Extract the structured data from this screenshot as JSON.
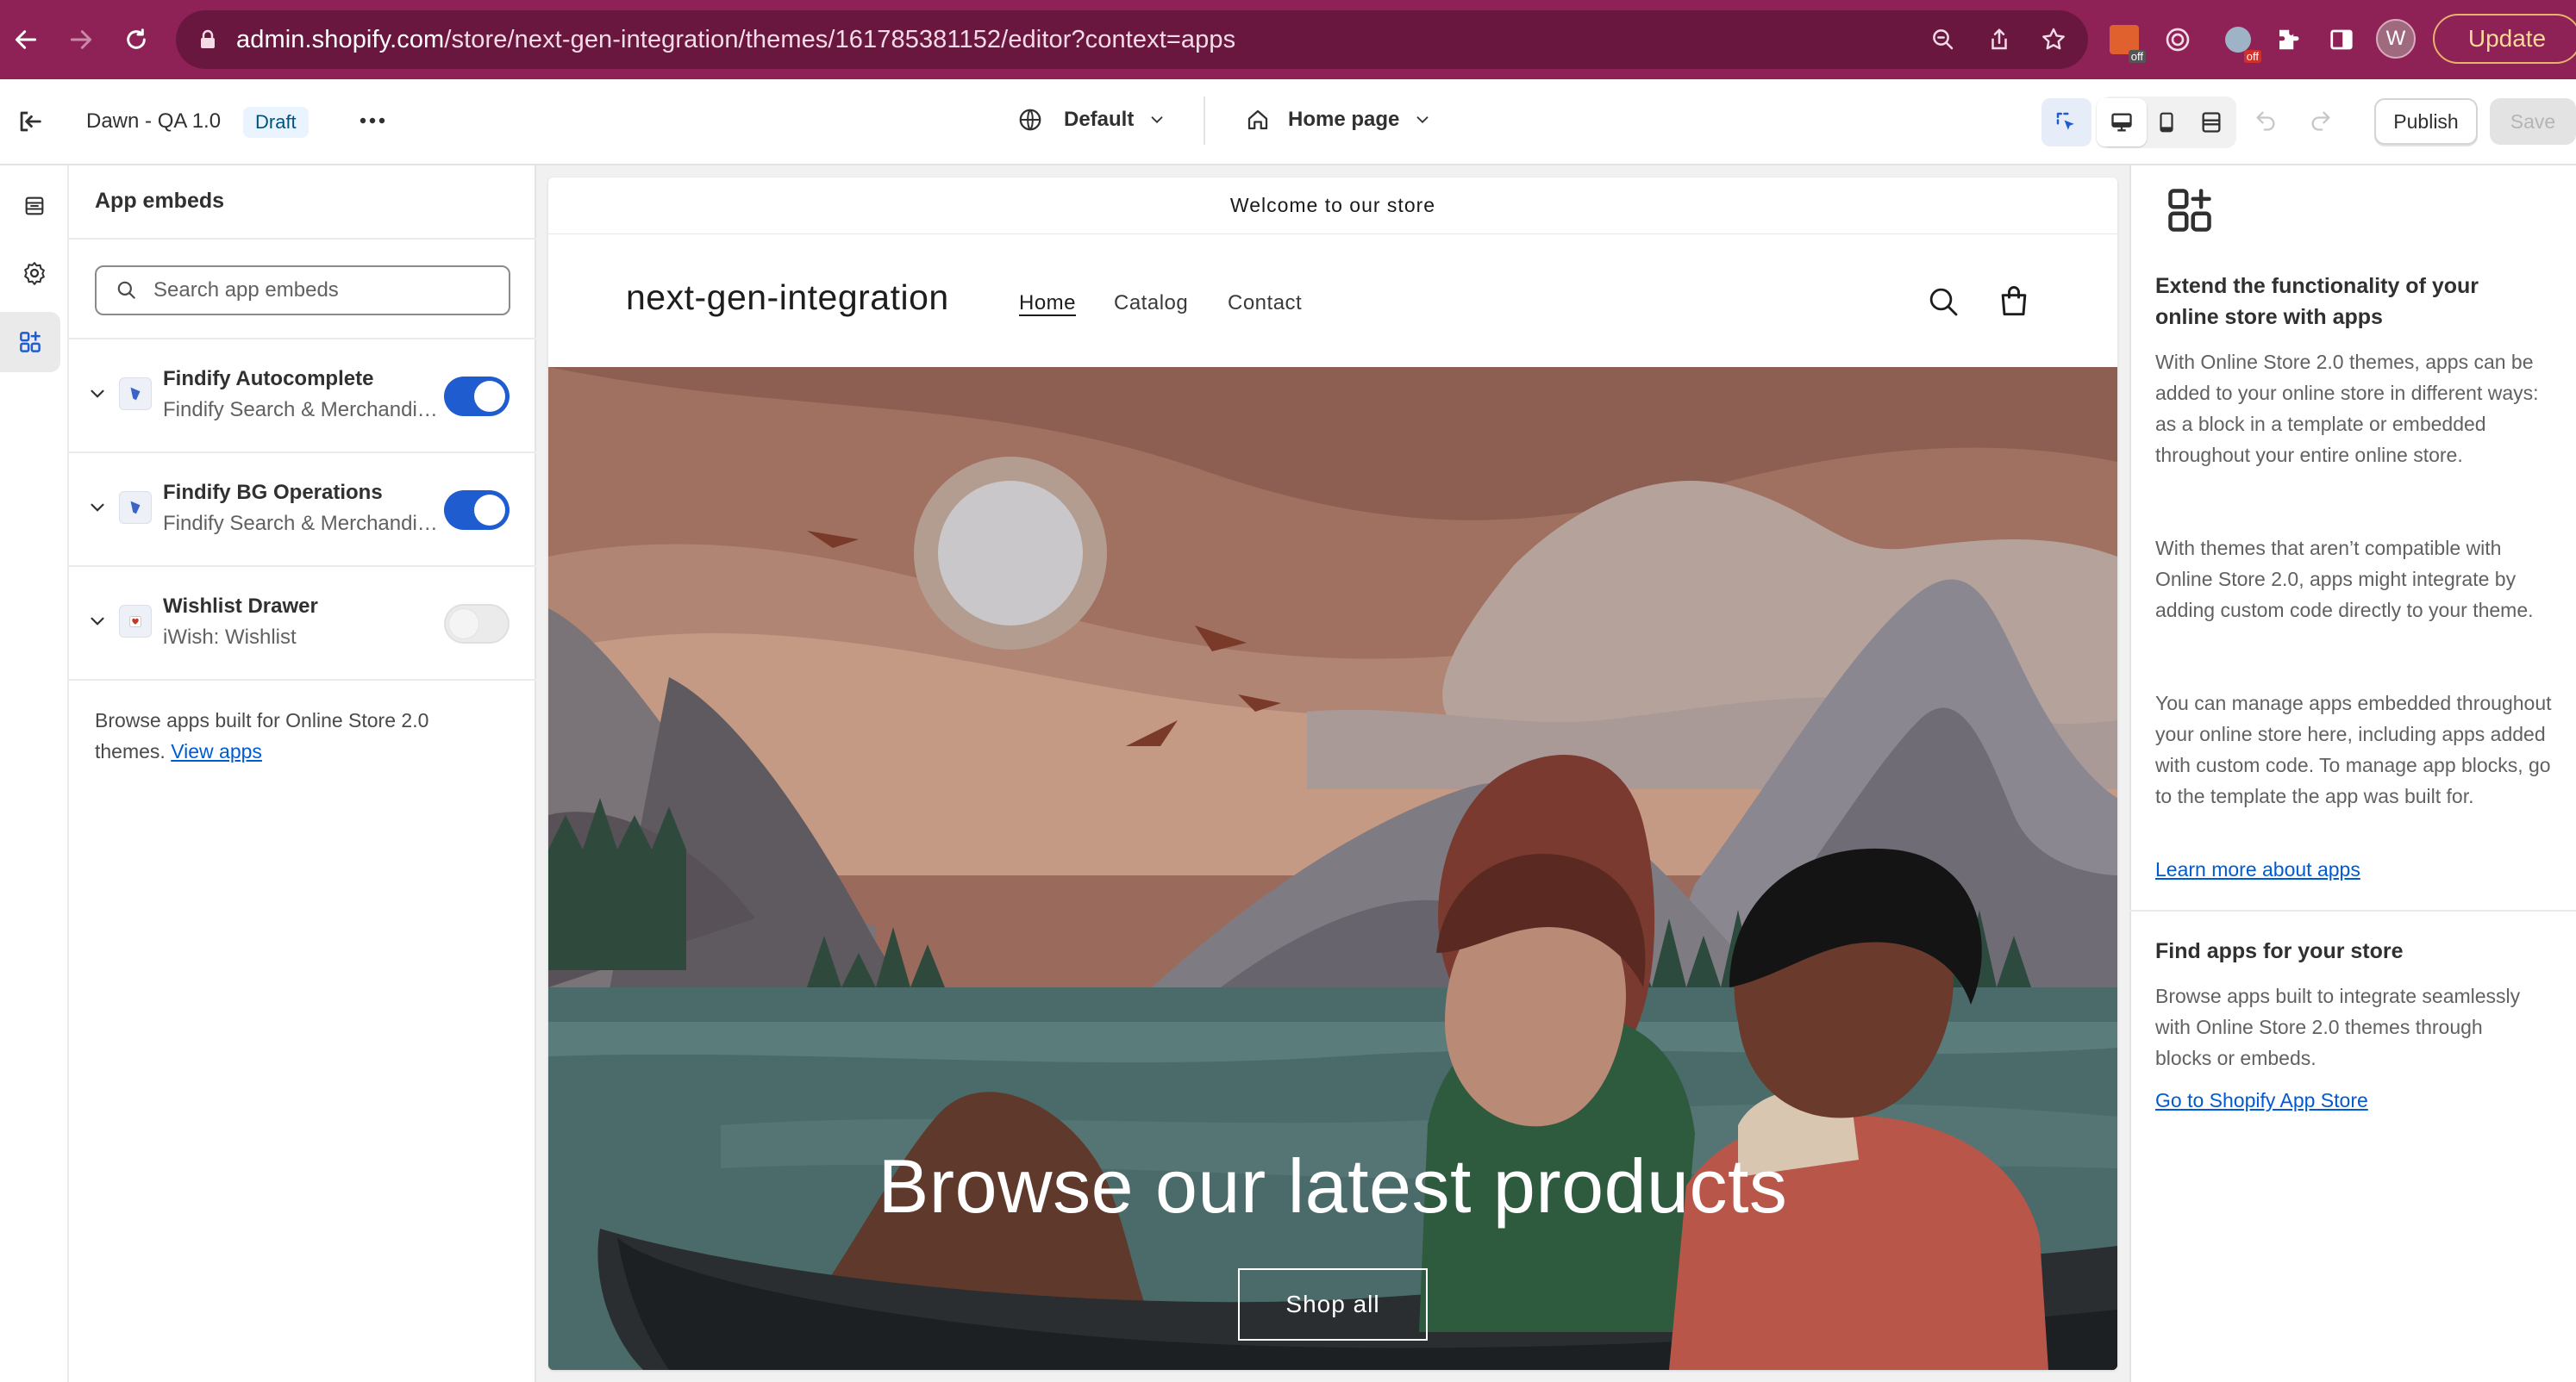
{
  "browser": {
    "url_domain": "admin.shopify.com",
    "url_path": "/store/next-gen-integration/themes/161785381152/editor?context=apps",
    "avatar_letter": "W",
    "update_label": "Update",
    "ext_badge_1": "off",
    "ext_badge_2": "off"
  },
  "toolbar": {
    "theme_name": "Dawn - QA 1.0",
    "status_badge": "Draft",
    "template_selector": "Default",
    "page_selector": "Home page",
    "publish_label": "Publish",
    "save_label": "Save"
  },
  "sidebar": {
    "title": "App embeds",
    "search_placeholder": "Search app embeds",
    "embeds": [
      {
        "title": "Findify Autocomplete",
        "subtitle": "Findify Search & Merchandising",
        "enabled": true
      },
      {
        "title": "Findify BG Operations",
        "subtitle": "Findify Search & Merchandising",
        "enabled": true
      },
      {
        "title": "Wishlist Drawer",
        "subtitle": "iWish: Wishlist",
        "enabled": false
      }
    ],
    "browse_text": "Browse apps built for Online Store 2.0 themes.",
    "browse_link": "View apps"
  },
  "preview": {
    "announcement": "Welcome to our store",
    "store_name": "next-gen-integration",
    "nav": [
      "Home",
      "Catalog",
      "Contact"
    ],
    "hero_heading": "Browse our latest products",
    "hero_button": "Shop all"
  },
  "right_panel": {
    "section1_title": "Extend the functionality of your online store with apps",
    "section1_p1": "With Online Store 2.0 themes, apps can be added to your online store in different ways: as a block in a template or embedded throughout your entire online store.",
    "section1_p2": "With themes that aren’t compatible with Online Store 2.0, apps might integrate by adding custom code directly to your theme.",
    "section1_p3": "You can manage apps embedded throughout your online store here, including apps added with custom code. To manage app blocks, go to the template the app was built for.",
    "section1_link": "Learn more about apps",
    "section2_title": "Find apps for your store",
    "section2_p": "Browse apps built to integrate seamlessly with Online Store 2.0 themes through blocks or embeds.",
    "section2_link": "Go to Shopify App Store"
  },
  "colors": {
    "chrome": "#8e2155",
    "accent": "#1f5ccf",
    "link": "#005bd3"
  }
}
